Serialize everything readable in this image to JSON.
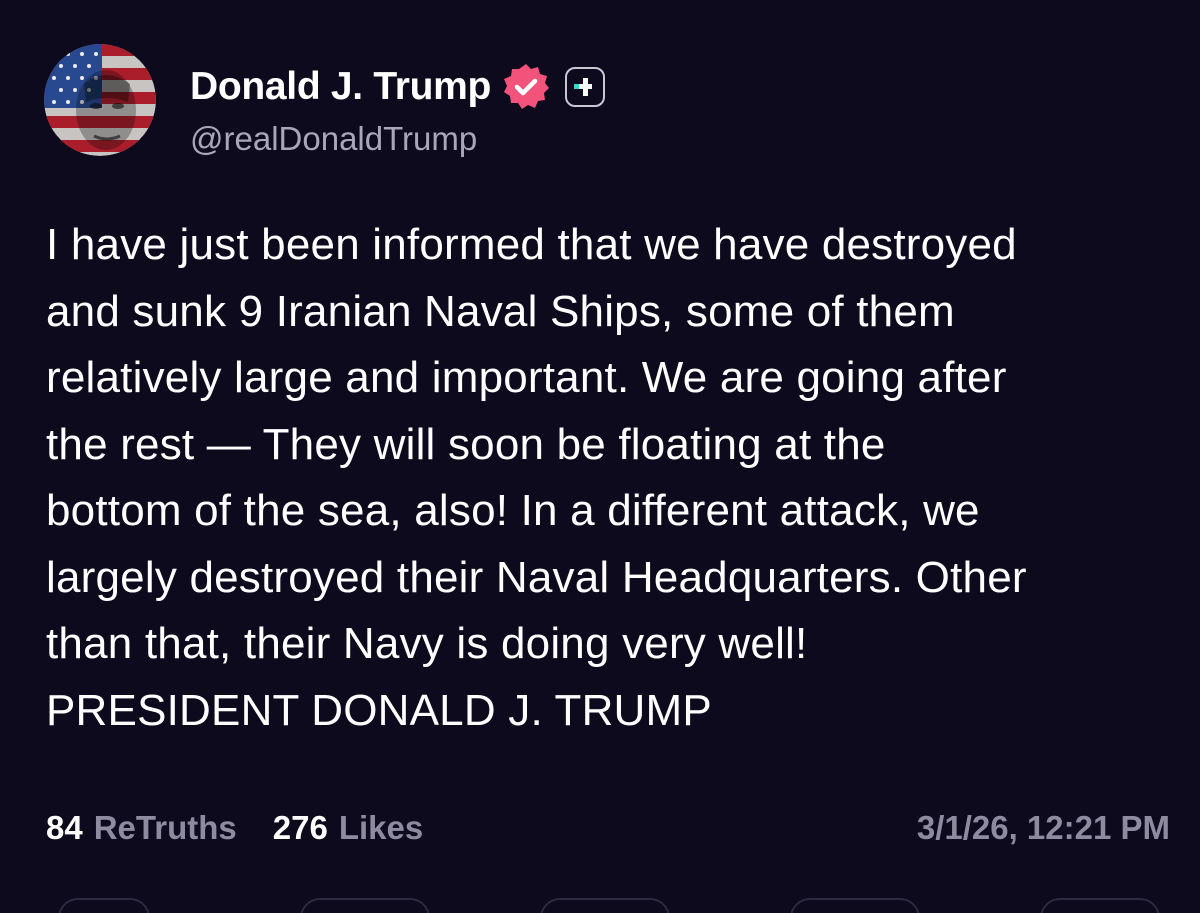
{
  "author": {
    "display_name": "Donald J. Trump",
    "handle": "@realDonaldTrump",
    "verified_icon": "verified-badge-icon",
    "verified_color": "#f2537b",
    "plus_icon": "truth-plus-icon",
    "plus_accent": "#3ad6c6"
  },
  "post": {
    "text": "I have just been informed that we have destroyed\nand sunk 9 Iranian Naval Ships, some of them\nrelatively large and important. We are going after\nthe rest — They will soon be floating at the\nbottom of the sea, also! In a different attack, we\nlargely destroyed their Naval Headquarters. Other\nthan that, their Navy is doing very well!\nPRESIDENT DONALD J. TRUMP"
  },
  "stats": {
    "retruths_count": "84",
    "retruths_label": "ReTruths",
    "likes_count": "276",
    "likes_label": "Likes"
  },
  "timestamp": "3/1/26, 12:21 PM",
  "colors": {
    "background": "#0c0a1c",
    "secondary_text": "#8e8ba0"
  }
}
